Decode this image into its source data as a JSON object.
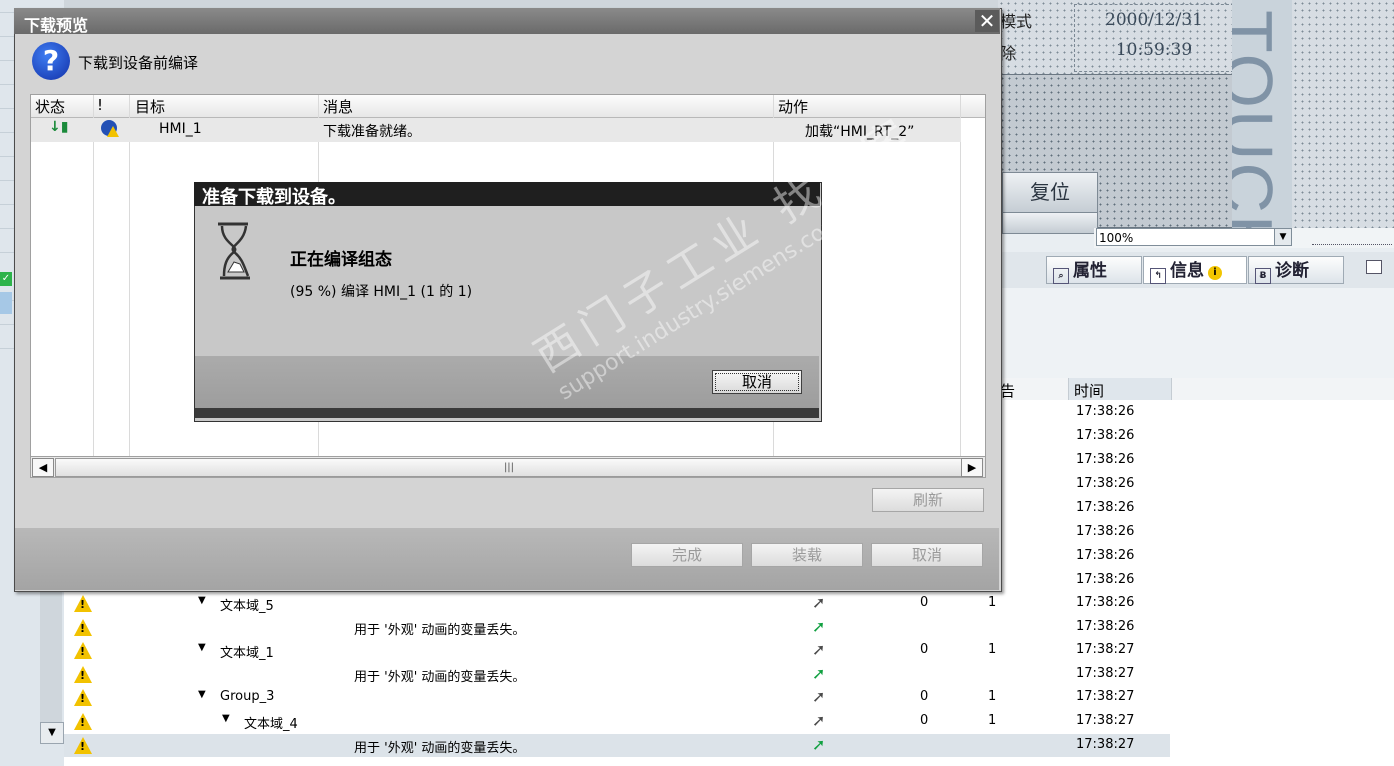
{
  "hmi": {
    "label_mode": "模式",
    "label_delete": "除",
    "date": "2000/12/31",
    "time": "10:59:39",
    "touch_text": "TOUCH",
    "reset_button": "复位",
    "zoom_value": "100%"
  },
  "inspector_tabs": [
    {
      "label": "属性",
      "icon": "properties-icon"
    },
    {
      "label": "信息",
      "icon": "info-icon",
      "badge": "i"
    },
    {
      "label": "诊断",
      "icon": "diagnostics-icon"
    }
  ],
  "log": {
    "columns": {
      "warning": "告",
      "time": "时间"
    },
    "rows_above": [
      "17:38:26",
      "17:38:26",
      "17:38:26",
      "17:38:26",
      "17:38:26",
      "17:38:26",
      "17:38:26",
      "17:38:26"
    ],
    "rows": [
      {
        "indent": 1,
        "label": "文本域_5",
        "expand": "▼",
        "arrow_color": "#4a4a4a",
        "col_a": "0",
        "col_b": "1",
        "time": "17:38:26"
      },
      {
        "indent": 2,
        "label": "用于 '外观' 动画的变量丢失。",
        "expand": "",
        "arrow_color": "#10a040",
        "col_a": "",
        "col_b": "",
        "time": "17:38:26"
      },
      {
        "indent": 1,
        "label": "文本域_1",
        "expand": "▼",
        "arrow_color": "#4a4a4a",
        "col_a": "0",
        "col_b": "1",
        "time": "17:38:27"
      },
      {
        "indent": 2,
        "label": "用于 '外观' 动画的变量丢失。",
        "expand": "",
        "arrow_color": "#10a040",
        "col_a": "",
        "col_b": "",
        "time": "17:38:27"
      },
      {
        "indent": 1,
        "label": "Group_3",
        "expand": "▼",
        "arrow_color": "#4a4a4a",
        "col_a": "0",
        "col_b": "1",
        "time": "17:38:27"
      },
      {
        "indent": 1.3,
        "label": "文本域_4",
        "expand": "▼",
        "arrow_color": "#4a4a4a",
        "col_a": "0",
        "col_b": "1",
        "time": "17:38:27"
      },
      {
        "indent": 2,
        "label": "用于 '外观' 动画的变量丢失。",
        "expand": "",
        "arrow_color": "#10a040",
        "col_a": "",
        "col_b": "",
        "time": "17:38:27",
        "selected": true
      }
    ]
  },
  "dialog": {
    "title": "下载预览",
    "heading": "下载到设备前编译",
    "columns": {
      "status": "状态",
      "bang": "!",
      "target": "目标",
      "message": "消息",
      "action": "动作"
    },
    "row": {
      "target": "HMI_1",
      "message": "下载准备就绪。",
      "action": "加载“HMI_RT_2”"
    },
    "refresh": "刷新",
    "finish": "完成",
    "load": "装载",
    "cancel": "取消"
  },
  "progress": {
    "title": "准备下载到设备。",
    "heading": "正在编译组态",
    "status": "(95 %) 编译 HMI_1 (1 的 1)",
    "cancel": "取消"
  },
  "watermark": {
    "line1": "西门子工业  找答案",
    "line2": "support.industry.siemens.com/cs"
  }
}
